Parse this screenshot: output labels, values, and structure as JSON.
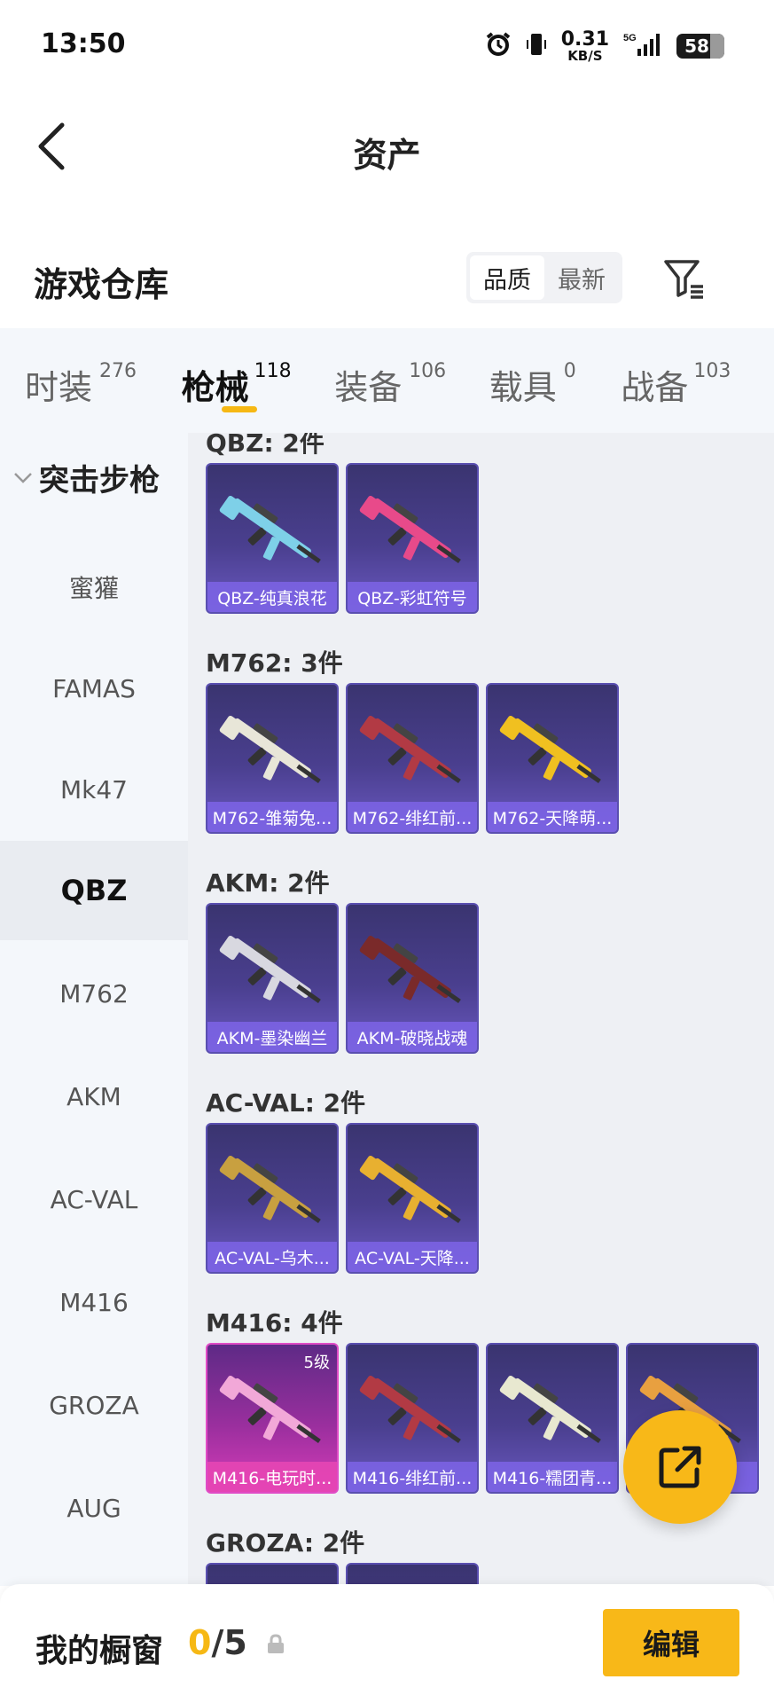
{
  "status_bar": {
    "time": "13:50",
    "speed_value": "0.31",
    "speed_unit": "KB/S",
    "network": "5G",
    "battery": "58"
  },
  "header": {
    "title": "资产"
  },
  "warehouse": {
    "title": "游戏仓库",
    "sort_options": [
      "品质",
      "最新"
    ],
    "active_sort": "品质"
  },
  "tabs": [
    {
      "label": "时装",
      "count": "276"
    },
    {
      "label": "枪械",
      "count": "118",
      "active": true
    },
    {
      "label": "装备",
      "count": "106"
    },
    {
      "label": "载具",
      "count": "0"
    },
    {
      "label": "战备",
      "count": "103"
    }
  ],
  "sidebar": {
    "group": "突击步枪",
    "items": [
      "蜜獾",
      "FAMAS",
      "Mk47",
      "QBZ",
      "M762",
      "AKM",
      "AC-VAL",
      "M416",
      "GROZA",
      "AUG"
    ],
    "active": "QBZ"
  },
  "groups": [
    {
      "title": "QBZ: 2件",
      "items": [
        {
          "name": "QBZ-纯真浪花",
          "palette": "#7ed0e8"
        },
        {
          "name": "QBZ-彩虹符号",
          "palette": "#e84a8a"
        }
      ]
    },
    {
      "title": "M762: 3件",
      "items": [
        {
          "name": "M762-雏菊兔...",
          "palette": "#e8e6d8"
        },
        {
          "name": "M762-绯红前...",
          "palette": "#b23a44"
        },
        {
          "name": "M762-天降萌...",
          "palette": "#f0c020"
        }
      ]
    },
    {
      "title": "AKM: 2件",
      "items": [
        {
          "name": "AKM-墨染幽兰",
          "palette": "#d8d8e0"
        },
        {
          "name": "AKM-破晓战魂",
          "palette": "#7a2a2a"
        }
      ]
    },
    {
      "title": "AC-VAL: 2件",
      "items": [
        {
          "name": "AC-VAL-乌木...",
          "palette": "#c8a040"
        },
        {
          "name": "AC-VAL-天降...",
          "palette": "#e8b030"
        }
      ]
    },
    {
      "title": "M416: 4件",
      "items": [
        {
          "name": "M416-电玩时...",
          "palette": "#f2a8d8",
          "level": "5级",
          "pink": true
        },
        {
          "name": "M416-绯红前...",
          "palette": "#b23a44"
        },
        {
          "name": "M416-糯团青...",
          "palette": "#e8e8d0"
        },
        {
          "name": "M416-...",
          "palette": "#e8a040"
        }
      ]
    },
    {
      "title": "GROZA: 2件",
      "items": []
    }
  ],
  "bottom": {
    "showcase_title": "我的橱窗",
    "count_current": "0",
    "count_total": "/5",
    "edit_label": "编辑"
  },
  "colors": {
    "accent": "#f8b818",
    "card": "#4a3f8f",
    "sidebar": "#f4f7fb"
  }
}
